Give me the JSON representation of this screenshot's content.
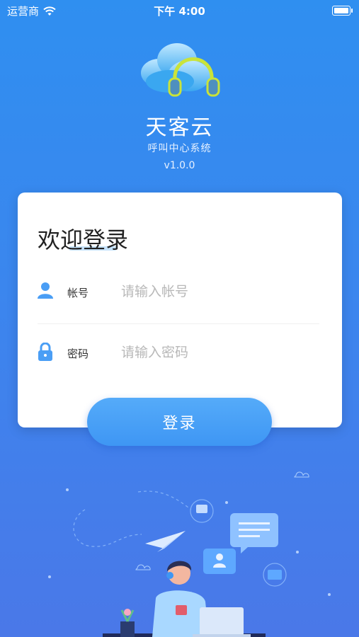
{
  "status_bar": {
    "carrier": "运营商",
    "time": "下午 4:00"
  },
  "app": {
    "title": "天客云",
    "subtitle": "呼叫中心系统",
    "version": "v1.0.0"
  },
  "login": {
    "welcome": "欢迎登录",
    "account_label": "帐号",
    "account_placeholder": "请输入帐号",
    "password_label": "密码",
    "password_placeholder": "请输入密码",
    "submit_label": "登录"
  },
  "colors": {
    "accent": "#3e96f4",
    "background_top": "#2f8ff0",
    "background_bottom": "#4a78e8"
  },
  "icons": [
    "wifi-icon",
    "battery-icon",
    "cloud-headphones-logo",
    "user-icon",
    "lock-icon"
  ]
}
